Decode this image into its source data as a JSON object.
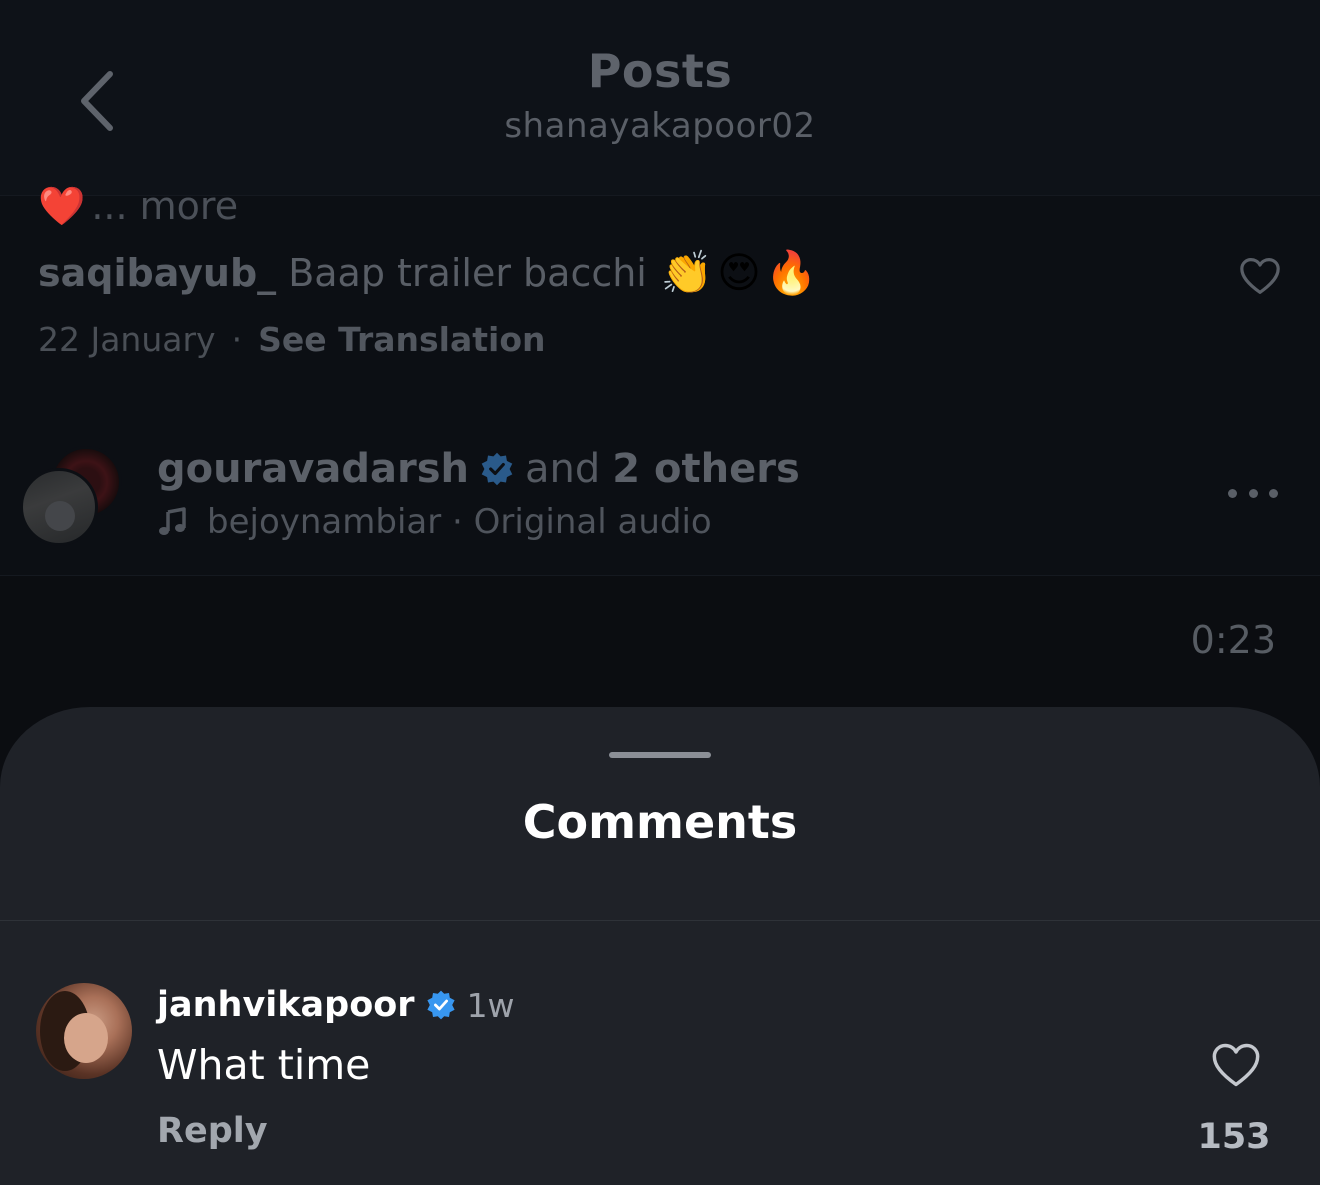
{
  "header": {
    "title": "Posts",
    "subtitle": "shanayakapoor02"
  },
  "caption": {
    "more_label": "... more",
    "heart_emoji": "❤️"
  },
  "top_comment": {
    "username": "saqibayub_",
    "text": "Baap trailer bacchi",
    "emojis": "👏😍🔥",
    "date": "22 January",
    "separator": "·",
    "translate_label": "See Translation"
  },
  "audio": {
    "liked_by_user": "gouravadarsh",
    "and_label": "and",
    "others_label": "2 others",
    "audio_line": "bejoynambiar · Original audio"
  },
  "video": {
    "duration": "0:23"
  },
  "sheet": {
    "title": "Comments"
  },
  "comment": {
    "username": "janhvikapoor",
    "time": "1w",
    "text": "What time",
    "reply_label": "Reply",
    "like_count": "153"
  },
  "colors": {
    "sheet_bg": "#1f2228",
    "verified_blue": "#3897f0",
    "background": "#0b0e13"
  },
  "icons": [
    "chevron-left-icon",
    "heart-outline-icon",
    "verified-badge-icon",
    "music-note-icon",
    "more-dots-icon"
  ]
}
